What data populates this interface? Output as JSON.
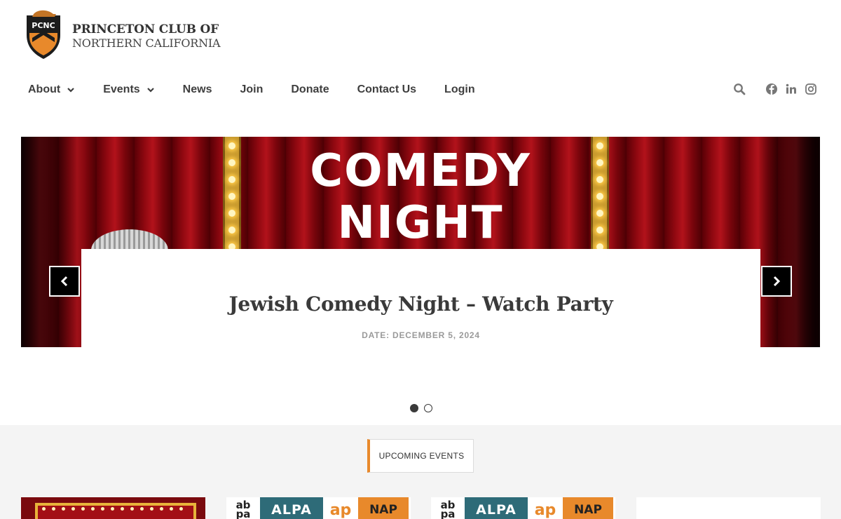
{
  "header": {
    "logo_text": "PCNC",
    "org_name_line1": "PRINCETON CLUB OF",
    "org_name_line2": "NORTHERN CALIFORNIA"
  },
  "nav": {
    "items": [
      {
        "label": "About",
        "has_dropdown": true
      },
      {
        "label": "Events",
        "has_dropdown": true
      },
      {
        "label": "News",
        "has_dropdown": false
      },
      {
        "label": "Join",
        "has_dropdown": false
      },
      {
        "label": "Donate",
        "has_dropdown": false
      },
      {
        "label": "Contact Us",
        "has_dropdown": false
      },
      {
        "label": "Login",
        "has_dropdown": false
      }
    ],
    "icons": [
      "search-icon",
      "facebook-icon",
      "linkedin-icon",
      "instagram-icon"
    ]
  },
  "hero": {
    "image_text_line1": "COMEDY",
    "image_text_line2": "NIGHT",
    "title": "Jewish Comedy Night – Watch Party",
    "date": "DATE: DECEMBER 5, 2024",
    "slide_count": 2,
    "active_slide": 1
  },
  "upcoming": {
    "tab_label": "UPCOMING EVENTS"
  },
  "event_logos": {
    "abpa_top": "ab",
    "abpa_bottom": "pa",
    "alpa": "ALPA",
    "ap": "ap",
    "nap": "NAP"
  },
  "colors": {
    "accent_orange": "#e8892b",
    "princeton_orange": "#e8892b",
    "text_dark": "#3b3b3b",
    "curtain_red": "#8e0810"
  }
}
